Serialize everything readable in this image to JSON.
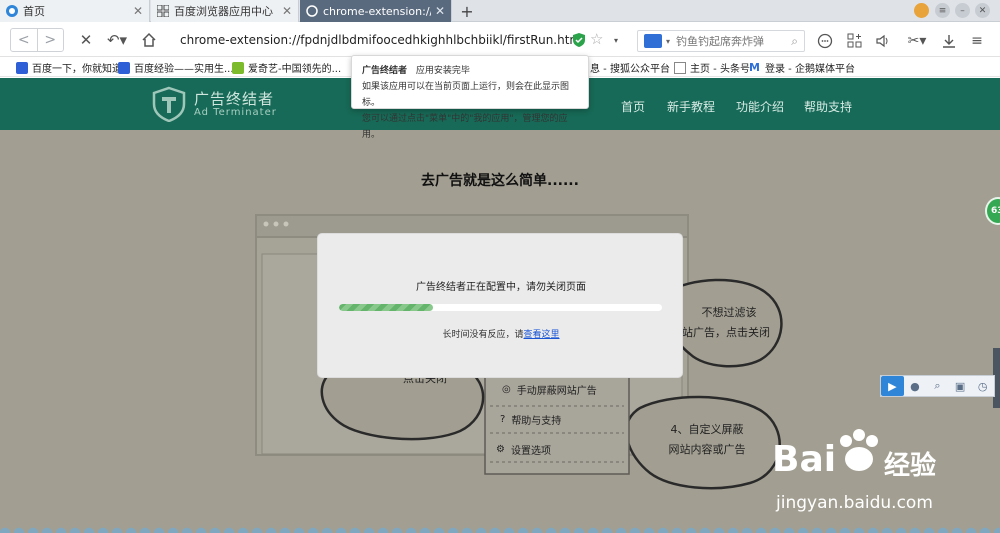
{
  "tabs": [
    {
      "label": "首页"
    },
    {
      "label": "百度浏览器应用中心"
    },
    {
      "label": "chrome-extension://fp..."
    }
  ],
  "address": {
    "url": "chrome-extension://fpdnjdlbdmifoocedhkighhlbchbiikl/firstRun.html"
  },
  "search": {
    "placeholder": "钓鱼钓起席奔炸弹"
  },
  "bookmarks": [
    {
      "label": "百度一下，你就知道"
    },
    {
      "label": "百度经验——实用生..."
    },
    {
      "label": "爱奇艺-中国领先的..."
    },
    {
      "label": "息 - 搜狐公众平台"
    },
    {
      "label": "主页 - 头条号"
    },
    {
      "label": "登录 - 企鹅媒体平台"
    }
  ],
  "popup": {
    "title": "广告终结者",
    "status": "应用安装完毕",
    "line1": "如果该应用可以在当前页面上运行，则会在此显示图标。",
    "line2": "您可以通过点击\"菜单\"中的\"我的应用\"，管理您的应用。"
  },
  "site": {
    "logo_cn": "广告终结者",
    "logo_en": "Ad Terminater",
    "nav": [
      "首页",
      "新手教程",
      "功能介绍",
      "帮助支持"
    ],
    "tagline": "去广告就是这么简单......"
  },
  "illustration": {
    "bubble_right_1": "不想过滤该",
    "bubble_right_2": "站广告，点击关闭",
    "bubble_left": "点击关闭",
    "bubble_bottom_1": "4、自定义屏蔽",
    "bubble_bottom_2": "网站内容或广告",
    "menu": [
      "手动屏蔽网站广告",
      "帮助与支持",
      "设置选项"
    ]
  },
  "modal": {
    "message": "广告终结者正在配置中，请勿关闭页面",
    "progress": 0.29,
    "hint_prefix": "长时间没有反应，请",
    "hint_link": "查看这里"
  },
  "side": {
    "badge": "63"
  },
  "watermark": {
    "brand": "Bai",
    "brand_cn": "经验",
    "url": "jingyan.baidu.com"
  },
  "colors": {
    "header_green": "#176a57",
    "progress_green": "#65b46b",
    "active_tab": "#5a6a7e",
    "page_bg": "#a29f92"
  }
}
